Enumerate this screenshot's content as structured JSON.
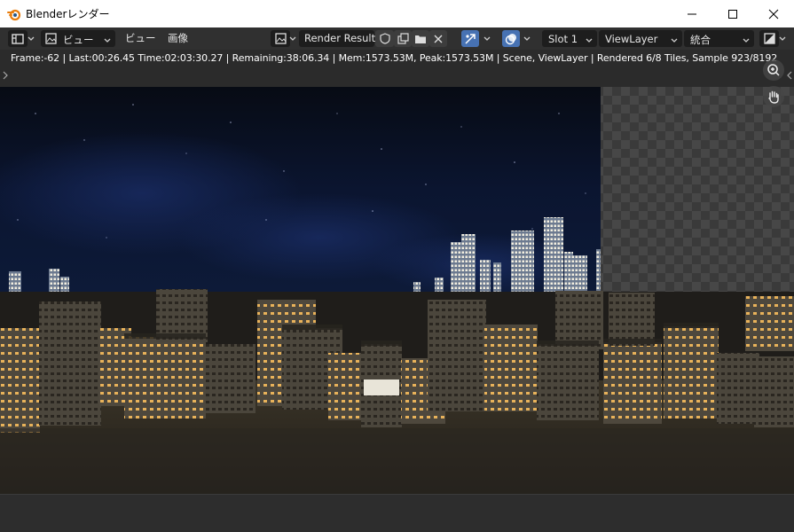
{
  "window": {
    "title": "Blenderレンダー",
    "controls": {
      "minimize": "minimize-icon",
      "maximize": "maximize-icon",
      "close": "close-icon"
    }
  },
  "header": {
    "view_menu": "ビュー",
    "view_menu2": "ビュー",
    "image_menu": "画像",
    "image_name": "Render Result",
    "slot": "Slot 1",
    "view_layer": "ViewLayer",
    "pass": "統合"
  },
  "stats": {
    "text": "Frame:-62 | Last:00:26.45 Time:02:03:30.27 | Remaining:38:06.34 | Mem:1573.53M, Peak:1573.53M | Scene, ViewLayer | Rendered 6/8 Tiles, Sample 923/8192"
  },
  "render": {
    "tiles_done": 6,
    "tiles_total": 8,
    "sample": 923,
    "samples_total": 8192
  },
  "colors": {
    "header_bg": "#303030",
    "button_dark": "#1d1d1d",
    "accent_blue": "#4772b3",
    "night_sky": "#0a1020",
    "ground": "#2e2920"
  }
}
